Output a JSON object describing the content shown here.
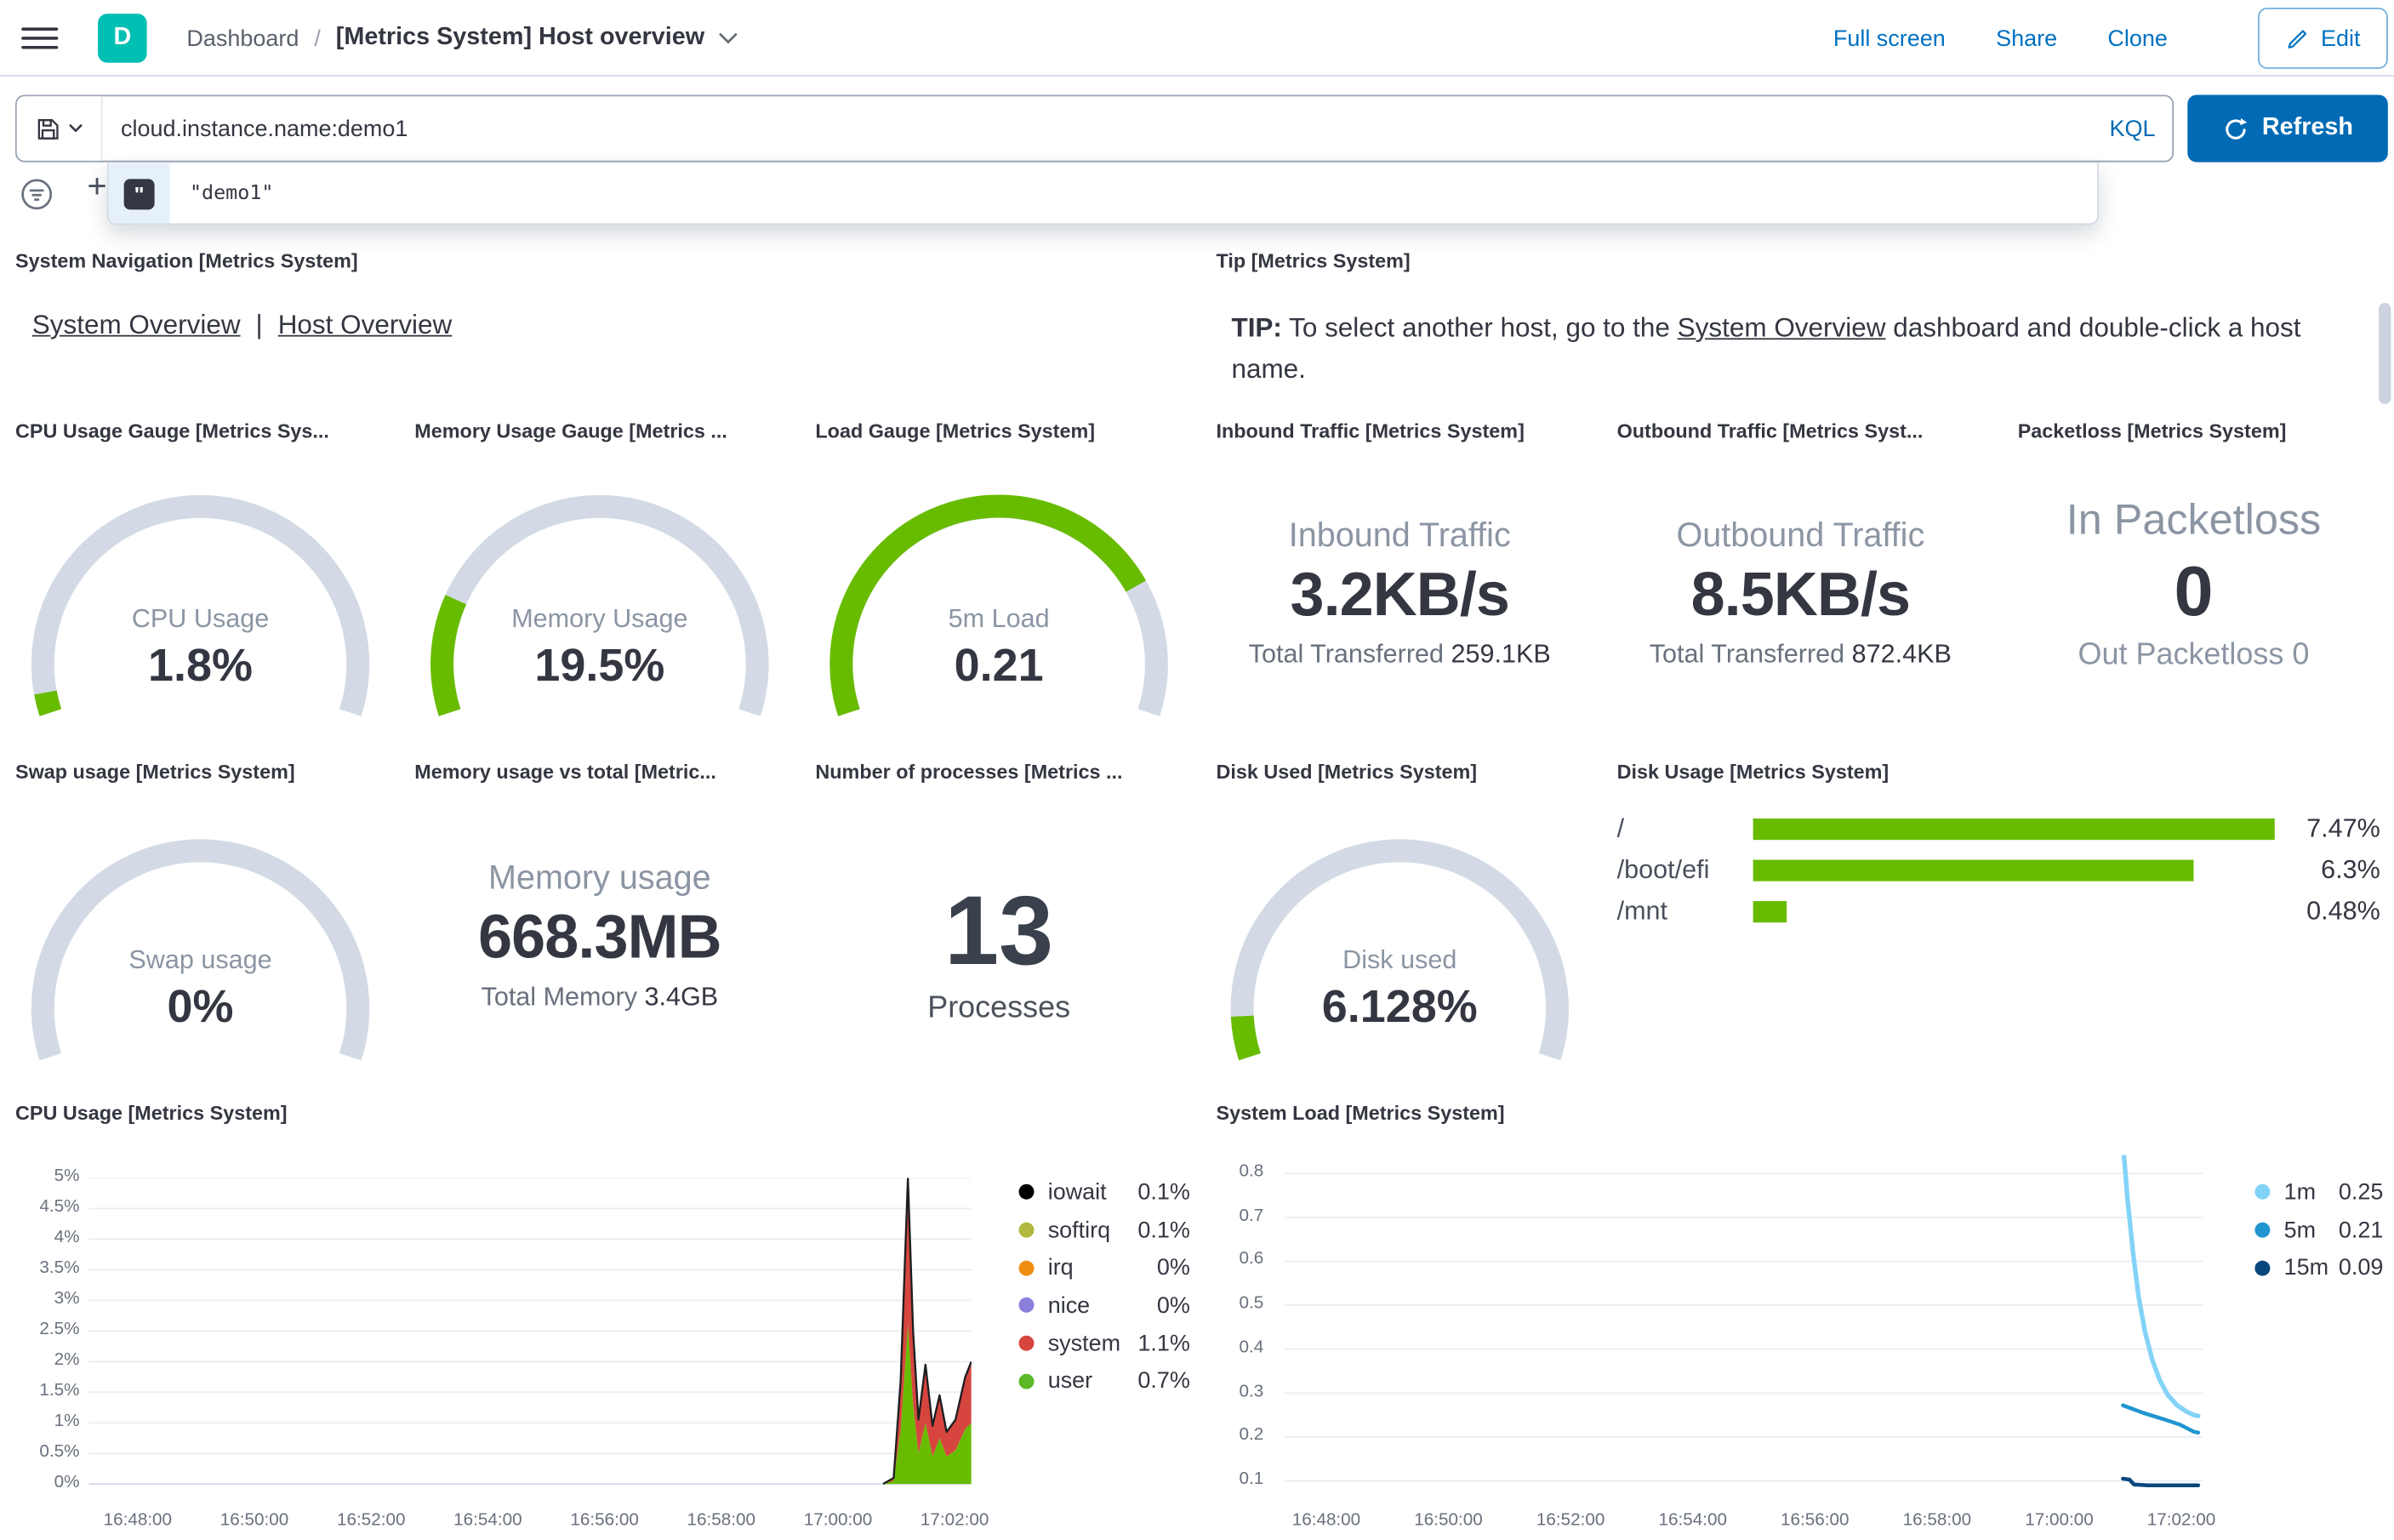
{
  "colors": {
    "link_blue": "#0071c2",
    "primary_button": "#006bb4",
    "space_badge_teal": "#00bfb3",
    "gauge_green": "#68bc00",
    "gauge_track": "#d3dae6",
    "text": "#343741",
    "subdued_text": "#69707d",
    "grid_line": "#e9edf3"
  },
  "header": {
    "space_badge": "D",
    "breadcrumb": {
      "root": "Dashboard",
      "separator": "/",
      "current": "[Metrics System] Host overview"
    },
    "actions": {
      "full_screen": "Full screen",
      "share": "Share",
      "clone": "Clone",
      "edit": "Edit"
    }
  },
  "query_bar": {
    "query": "cloud.instance.name:demo1",
    "language_label": "KQL",
    "refresh_label": "Refresh",
    "add_filter_label": "+",
    "suggestion_token_glyph": "\"",
    "suggestion_value": "\"demo1\""
  },
  "panels": {
    "system_navigation": {
      "title": "System Navigation [Metrics System]",
      "link1": "System Overview",
      "separator": "|",
      "link2": "Host Overview"
    },
    "tip": {
      "title": "Tip [Metrics System]",
      "prefix_bold": "TIP:",
      "text_before_link": " To select another host, go to the ",
      "link_text": "System Overview",
      "text_after_link": " dashboard and double-click a host name."
    },
    "cpu_gauge": {
      "title": "CPU Usage Gauge [Metrics Sys...",
      "label": "CPU Usage",
      "value": "1.8%",
      "fraction": 0.035
    },
    "memory_gauge": {
      "title": "Memory Usage Gauge [Metrics ...",
      "label": "Memory Usage",
      "value": "19.5%",
      "fraction": 0.195
    },
    "load_gauge": {
      "title": "Load Gauge [Metrics System]",
      "label": "5m Load",
      "value": "0.21",
      "fraction": 0.78
    },
    "inbound_traffic": {
      "title": "Inbound Traffic [Metrics System]",
      "label": "Inbound Traffic",
      "value": "3.2KB/s",
      "sub_label": "Total Transferred",
      "sub_value": "259.1KB"
    },
    "outbound_traffic": {
      "title": "Outbound Traffic [Metrics Syst...",
      "label": "Outbound Traffic",
      "value": "8.5KB/s",
      "sub_label": "Total Transferred",
      "sub_value": "872.4KB"
    },
    "packetloss": {
      "title": "Packetloss [Metrics System]",
      "in_label": "In Packetloss",
      "in_value": "0",
      "out_label": "Out Packetloss",
      "out_value": "0"
    },
    "swap_gauge": {
      "title": "Swap usage [Metrics System]",
      "label": "Swap usage",
      "value": "0%",
      "fraction": 0
    },
    "memory_vs_total": {
      "title": "Memory usage vs total [Metric...",
      "label": "Memory usage",
      "value": "668.3MB",
      "sub_label": "Total Memory",
      "sub_value": "3.4GB"
    },
    "processes": {
      "title": "Number of processes [Metrics ...",
      "value": "13",
      "label": "Processes"
    },
    "disk_used_gauge": {
      "title": "Disk Used [Metrics System]",
      "label": "Disk used",
      "value": "6.128%",
      "fraction": 0.07
    },
    "disk_usage": {
      "title": "Disk Usage [Metrics System]",
      "max_scale": 7.47,
      "bar_color": "#68bc00",
      "rows": [
        {
          "label": "/",
          "value": 7.47,
          "display": "7.47%"
        },
        {
          "label": "/boot/efi",
          "value": 6.3,
          "display": "6.3%"
        },
        {
          "label": "/mnt",
          "value": 0.48,
          "display": "0.48%"
        }
      ]
    },
    "cpu_chart": {
      "type": "area",
      "title": "CPU Usage [Metrics System]",
      "ylim": [
        0,
        5
      ],
      "y_ticks": [
        "5%",
        "4.5%",
        "4%",
        "3.5%",
        "3%",
        "2.5%",
        "2%",
        "1.5%",
        "1%",
        "0.5%",
        "0%"
      ],
      "x_ticks": [
        "16:48:00",
        "16:50:00",
        "16:52:00",
        "16:54:00",
        "16:56:00",
        "16:58:00",
        "17:00:00",
        "17:02:00"
      ],
      "legend": [
        {
          "name": "iowait",
          "value": "0.1%",
          "color": "#000000"
        },
        {
          "name": "softirq",
          "value": "0.1%",
          "color": "#b1b941"
        },
        {
          "name": "irq",
          "value": "0%",
          "color": "#ef8d12"
        },
        {
          "name": "nice",
          "value": "0%",
          "color": "#8a7fdb"
        },
        {
          "name": "system",
          "value": "1.1%",
          "color": "#d6463f"
        },
        {
          "name": "user",
          "value": "0.7%",
          "color": "#5cb826"
        }
      ],
      "outline_color": "#1d1e20",
      "series": [
        {
          "name": "user",
          "color": "#68bc00",
          "points": [
            [
              0.9,
              0
            ],
            [
              0.912,
              0.05
            ],
            [
              0.92,
              0.9
            ],
            [
              0.928,
              2.6
            ],
            [
              0.934,
              1.3
            ],
            [
              0.94,
              0.5
            ],
            [
              0.948,
              1.0
            ],
            [
              0.956,
              0.45
            ],
            [
              0.964,
              0.75
            ],
            [
              0.972,
              0.45
            ],
            [
              0.982,
              0.55
            ],
            [
              0.993,
              0.9
            ],
            [
              1.0,
              1.0
            ]
          ]
        },
        {
          "name": "system",
          "color": "#d6463f",
          "points": [
            [
              0.9,
              0
            ],
            [
              0.912,
              0.05
            ],
            [
              0.92,
              0.8
            ],
            [
              0.928,
              2.4
            ],
            [
              0.934,
              1.2
            ],
            [
              0.94,
              0.55
            ],
            [
              0.948,
              0.95
            ],
            [
              0.956,
              0.5
            ],
            [
              0.964,
              0.7
            ],
            [
              0.972,
              0.4
            ],
            [
              0.982,
              0.5
            ],
            [
              0.993,
              0.85
            ],
            [
              1.0,
              1.0
            ]
          ]
        }
      ]
    },
    "load_chart": {
      "type": "line",
      "title": "System Load [Metrics System]",
      "ylim": [
        0.1,
        0.8
      ],
      "y_ticks": [
        "0.8",
        "0.7",
        "0.6",
        "0.5",
        "0.4",
        "0.3",
        "0.2",
        "0.1"
      ],
      "x_ticks": [
        "16:48:00",
        "16:50:00",
        "16:52:00",
        "16:54:00",
        "16:56:00",
        "16:58:00",
        "17:00:00",
        "17:02:00"
      ],
      "legend": [
        {
          "name": "1m",
          "value": "0.25",
          "color": "#82d3f7"
        },
        {
          "name": "5m",
          "value": "0.21",
          "color": "#2095cf"
        },
        {
          "name": "15m",
          "value": "0.09",
          "color": "#07477e"
        }
      ],
      "series": [
        {
          "name": "1m",
          "color": "#82d3f7",
          "width": 3,
          "points": [
            [
              0.913,
              0.87
            ],
            [
              0.918,
              0.74
            ],
            [
              0.924,
              0.62
            ],
            [
              0.93,
              0.52
            ],
            [
              0.937,
              0.44
            ],
            [
              0.945,
              0.375
            ],
            [
              0.953,
              0.33
            ],
            [
              0.962,
              0.295
            ],
            [
              0.972,
              0.272
            ],
            [
              0.982,
              0.258
            ],
            [
              0.99,
              0.25
            ],
            [
              0.995,
              0.248
            ]
          ]
        },
        {
          "name": "5m",
          "color": "#2095cf",
          "width": 2.5,
          "points": [
            [
              0.913,
              0.272
            ],
            [
              0.935,
              0.255
            ],
            [
              0.958,
              0.24
            ],
            [
              0.975,
              0.228
            ],
            [
              0.99,
              0.212
            ],
            [
              0.995,
              0.21
            ]
          ]
        },
        {
          "name": "15m",
          "color": "#07477e",
          "width": 2.5,
          "points": [
            [
              0.913,
              0.105
            ],
            [
              0.92,
              0.103
            ],
            [
              0.925,
              0.092
            ],
            [
              0.94,
              0.09
            ],
            [
              0.995,
              0.09
            ]
          ]
        }
      ]
    }
  }
}
